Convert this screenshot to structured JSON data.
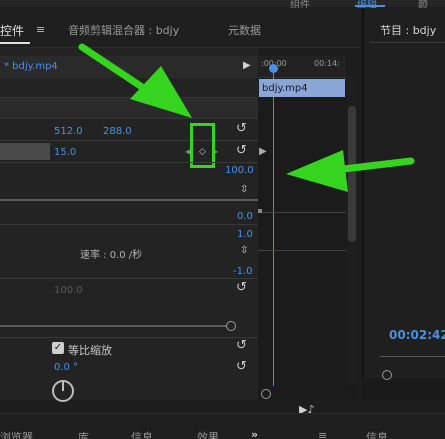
{
  "top_strip": {
    "words": [
      "组件",
      "编辑",
      "颜"
    ]
  },
  "left_panel": {
    "tabs": [
      {
        "label": "控件"
      },
      {
        "label": "音频剪辑混合器 : bdjy"
      },
      {
        "label": "元数据"
      }
    ],
    "tab_menu_icon": "≡",
    "clip_label": "* bdjy.mp4",
    "clip_play_icon": "▶",
    "position_x": "512.0",
    "position_y": "288.0",
    "scale_value": "15.0",
    "keyframe_prev": "◀",
    "keyframe_diamond": "◇",
    "keyframe_next": "▶",
    "graph_max": "100.0",
    "graph_zero": "0.0",
    "graph_one": "1.0",
    "graph_neg_one": "-1.0",
    "speed_label": "速率 : 0.0 /秒",
    "scale_width_value": "100.0",
    "uniform_scale_label": "等比缩放",
    "uniform_scale_checked": "✓",
    "rotation_value": "0.0 °",
    "reset_icon": "↺"
  },
  "timeline": {
    "tc_start": ":00:00",
    "tc_mid": "00:14:",
    "clip_label": "bdjy.mp4",
    "expand_arrow": "▶",
    "audio_icon": "▶♪"
  },
  "program_monitor": {
    "title": "节目 : bdjy",
    "timecode": "00:02:42"
  },
  "bottom_tabs": [
    "浏览器",
    "库",
    "信息",
    "效果",
    "≡",
    "信息"
  ],
  "bottom_more": "»",
  "colors": {
    "accent_blue": "#4a90e2",
    "annotation_green": "#35d41f"
  }
}
